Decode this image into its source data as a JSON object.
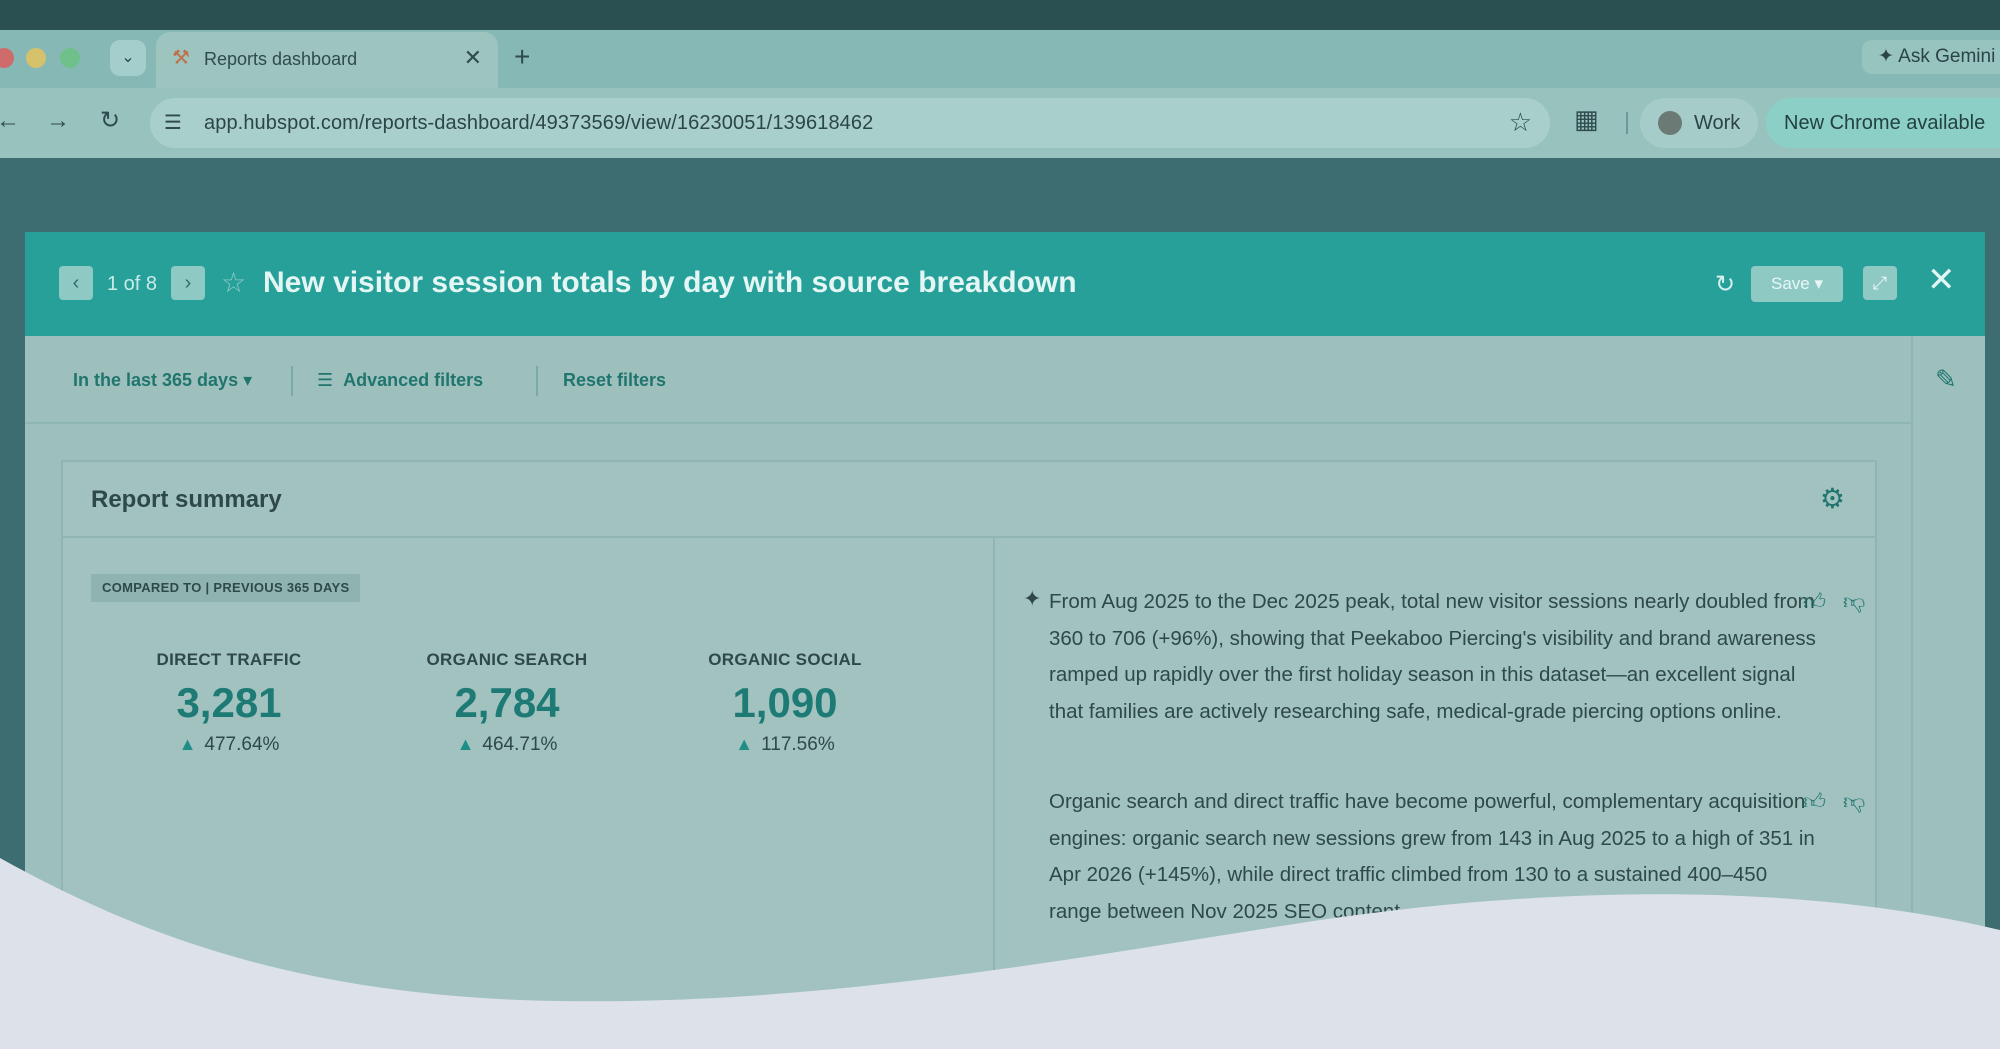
{
  "browser": {
    "tab_title": "Reports dashboard",
    "new_tab_symbol": "+",
    "ask_gemini_label": "Ask Gemini",
    "url": "app.hubspot.com/reports-dashboard/49373569/view/16230051/139618462",
    "profile_label": "Work",
    "update_label": "New Chrome available"
  },
  "modal": {
    "pager": "1 of 8",
    "title": "New visitor session totals by day with source breakdown",
    "save_label": "Save ▾"
  },
  "filters": {
    "date_range": "In the last 365 days ▾",
    "advanced": "Advanced filters",
    "reset": "Reset filters"
  },
  "summary": {
    "title": "Report summary",
    "compare_badge": "COMPARED TO | PREVIOUS 365 DAYS",
    "metrics": [
      {
        "label": "DIRECT TRAFFIC",
        "value": "3,281",
        "change": "477.64%"
      },
      {
        "label": "ORGANIC SEARCH",
        "value": "2,784",
        "change": "464.71%"
      },
      {
        "label": "ORGANIC SOCIAL",
        "value": "1,090",
        "change": "117.56%"
      }
    ],
    "insights": [
      "From Aug 2025 to the Dec 2025 peak, total new visitor sessions nearly doubled from 360 to 706 (+96%), showing that Peekaboo Piercing's visibility and brand awareness ramped up rapidly over the first holiday season in this dataset—an excellent signal that families are actively researching safe, medical-grade piercing options online.",
      "Organic search and direct traffic have become powerful, complementary acquisition engines: organic search new sessions grew from 143 in Aug 2025 to a high of 351 in Apr 2026 (+145%), while direct traffic climbed from 130 to a sustained 400–450 range between Nov 2025 SEO content"
    ]
  },
  "colors": {
    "header_teal": "#27a09a",
    "accent": "#21756f",
    "wave": "#dde1e9"
  }
}
